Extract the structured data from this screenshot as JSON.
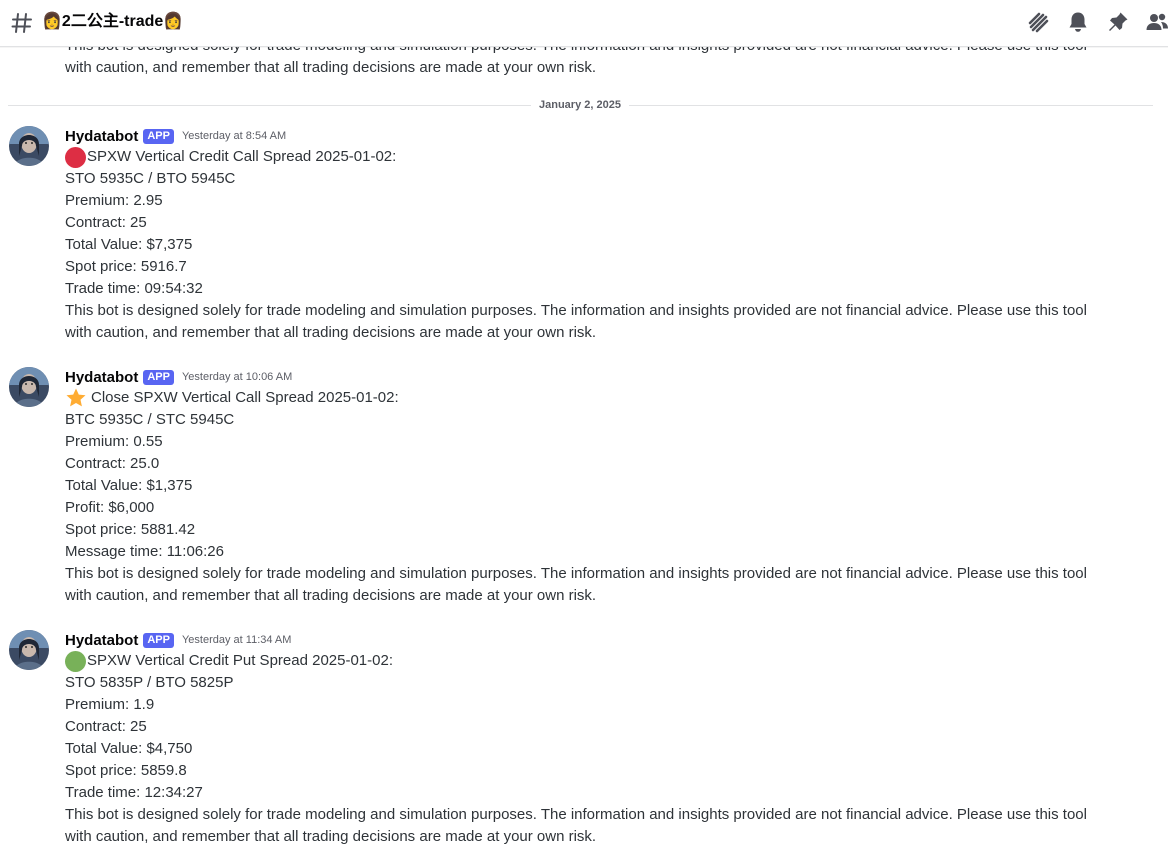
{
  "header": {
    "channel_name": "👩2二公主-trade👩",
    "icons": [
      "threads-icon",
      "bell-icon",
      "pin-icon",
      "members-icon"
    ]
  },
  "top_cut": {
    "text": "This bot is designed solely for trade modeling and simulation purposes. The information and insights provided are not financial advice. Please use this tool with caution, and remember that all trading decisions are made at your own risk."
  },
  "divider": {
    "label": "January 2, 2025"
  },
  "messages": [
    {
      "username": "Hydatabot",
      "badge": "APP",
      "timestamp": "Yesterday at 8:54 AM",
      "status_icon": "red-circle",
      "title": "SPXW Vertical Credit Call Spread 2025-01-02:",
      "lines": [
        "STO 5935C / BTO 5945C",
        "Premium: 2.95",
        "Contract: 25",
        "Total Value: $7,375",
        "Spot price: 5916.7",
        "Trade time: 09:54:32"
      ],
      "disclaimer": "This bot is designed solely for trade modeling and simulation purposes. The information and insights provided are not financial advice. Please use this tool with caution, and remember that all trading decisions are made at your own risk."
    },
    {
      "username": "Hydatabot",
      "badge": "APP",
      "timestamp": "Yesterday at 10:06 AM",
      "status_icon": "star",
      "title": "Close SPXW Vertical Call Spread 2025-01-02:",
      "lines": [
        "BTC 5935C / STC 5945C",
        "Premium: 0.55",
        "Contract: 25.0",
        "Total Value: $1,375",
        "Profit: $6,000",
        "Spot price: 5881.42",
        "Message time: 11:06:26"
      ],
      "disclaimer": "This bot is designed solely for trade modeling and simulation purposes. The information and insights provided are not financial advice. Please use this tool with caution, and remember that all trading decisions are made at your own risk."
    },
    {
      "username": "Hydatabot",
      "badge": "APP",
      "timestamp": "Yesterday at 11:34 AM",
      "status_icon": "green-circle",
      "title": "SPXW Vertical Credit Put Spread 2025-01-02:",
      "lines": [
        "STO 5835P / BTO 5825P",
        "Premium: 1.9",
        "Contract: 25",
        "Total Value: $4,750",
        "Spot price: 5859.8",
        "Trade time: 12:34:27"
      ],
      "disclaimer": "This bot is designed solely for trade modeling and simulation purposes. The information and insights provided are not financial advice. Please use this tool with caution, and remember that all trading decisions are made at your own risk."
    }
  ],
  "colors": {
    "badge": "#5865f2",
    "red_circle": "#dd2e44",
    "green_circle": "#78b159",
    "star": "#ffac33",
    "icon": "#4e5058"
  }
}
